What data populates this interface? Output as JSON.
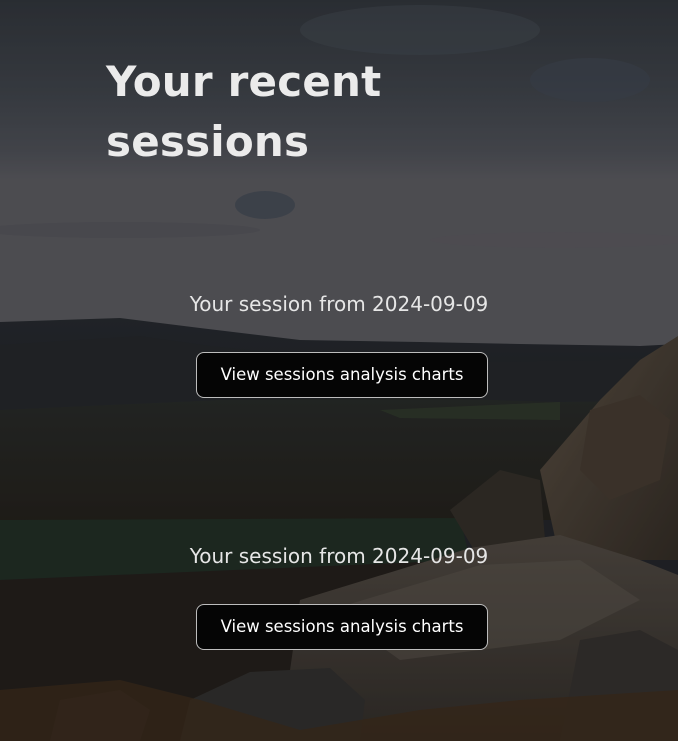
{
  "page": {
    "title": "Your recent sessions"
  },
  "sessions": [
    {
      "heading": "Your session from 2024-09-09",
      "button_label": "View sessions analysis charts"
    },
    {
      "heading": "Your session from 2024-09-09",
      "button_label": "View sessions analysis charts"
    }
  ],
  "background": {
    "image": "moorland-rocks-dusk-photo",
    "overlay_color": "#000000"
  }
}
